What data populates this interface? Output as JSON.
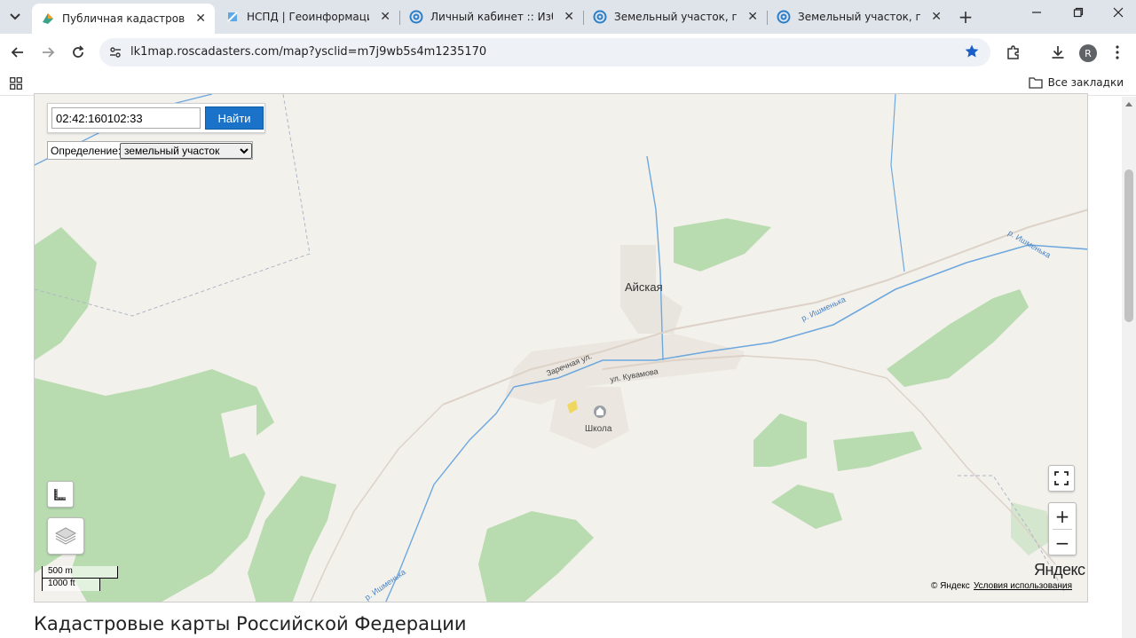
{
  "browser": {
    "tabs": [
      {
        "label": "Публичная кадастровая карта",
        "active": true
      },
      {
        "label": "НСПД | Геоинформационная",
        "active": false
      },
      {
        "label": "Личный кабинет :: Избранное",
        "active": false
      },
      {
        "label": "Земельный участок, площадь",
        "active": false
      },
      {
        "label": "Земельный участок, площадь",
        "active": false
      }
    ],
    "url": "lk1map.roscadasters.com/map?ysclid=m7j9wb5s4m1235170",
    "profile_initial": "R",
    "bookmarks_all": "Все закладки"
  },
  "map": {
    "search_value": "02:42:160102:33",
    "search_button": "Найти",
    "definition_label": "Определение:",
    "definition_selected": "земельный участок",
    "labels": {
      "village": "Айская",
      "street1": "Заречная ул.",
      "street2": "ул. Кувамова",
      "school": "Школа",
      "river1": "р. Ишменька",
      "river2": "р. Ишменька",
      "river3": "р. Ишменька"
    },
    "scale_metric": "500 m",
    "scale_imperial": "1000 ft",
    "zoom_in": "+",
    "zoom_out": "−",
    "copyright": "© Яндекс",
    "terms": "Условия использования",
    "logo": "Яндекс"
  },
  "page": {
    "heading": "Кадастровые карты Российской Федерации"
  },
  "colors": {
    "green": "#b8dcb0",
    "river": "#6ea8de",
    "button": "#1a73c8"
  }
}
